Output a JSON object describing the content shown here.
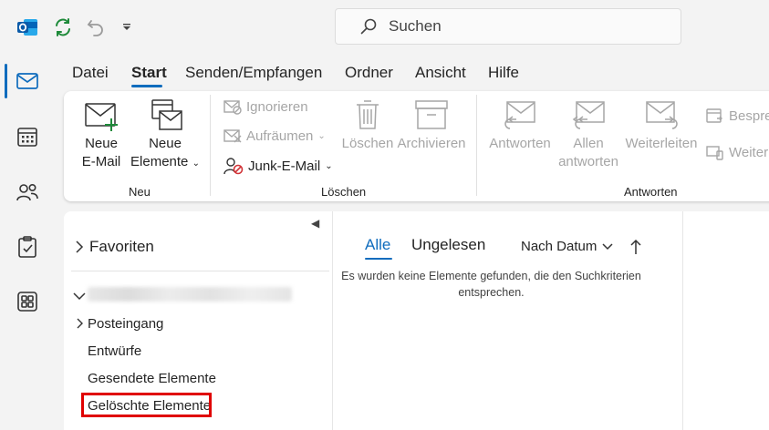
{
  "colors": {
    "accent": "#0f6cbd",
    "highlight": "#e00000",
    "disabled": "#a6a6a6"
  },
  "titlebar": {
    "icons": [
      "outlook-logo-icon",
      "sync-icon",
      "undo-icon",
      "customize-dropdown-icon"
    ],
    "search": {
      "placeholder": "Suchen",
      "icon": "search-icon"
    }
  },
  "rail": [
    "mail-icon",
    "calendar-icon",
    "people-icon",
    "tasks-icon",
    "apps-icon"
  ],
  "menu": {
    "tabs": [
      "Datei",
      "Start",
      "Senden/Empfangen",
      "Ordner",
      "Ansicht",
      "Hilfe"
    ],
    "active": "Start"
  },
  "ribbon": {
    "neu": {
      "label": "Neu",
      "new_email": [
        "Neue",
        "E-Mail"
      ],
      "new_items": [
        "Neue",
        "Elemente"
      ]
    },
    "loeschen": {
      "label": "Löschen",
      "ignore": "Ignorieren",
      "cleanup": "Aufräumen",
      "junk": "Junk-E-Mail",
      "delete": "Löschen",
      "archive": "Archivieren"
    },
    "antworten": {
      "label": "Antworten",
      "reply": "Antworten",
      "reply_all": [
        "Allen",
        "antworten"
      ],
      "forward": "Weiterleiten",
      "meeting": "Bespre",
      "more": "Weiter"
    }
  },
  "folders": {
    "favorites": "Favoriten",
    "items": [
      "Posteingang",
      "Entwürfe",
      "Gesendete Elemente",
      "Gelöschte Elemente"
    ]
  },
  "message_list": {
    "tab_all": "Alle",
    "tab_unread": "Ungelesen",
    "sort": "Nach Datum",
    "empty_text": "Es wurden keine Elemente gefunden, die den Suchkriterien entsprechen."
  }
}
